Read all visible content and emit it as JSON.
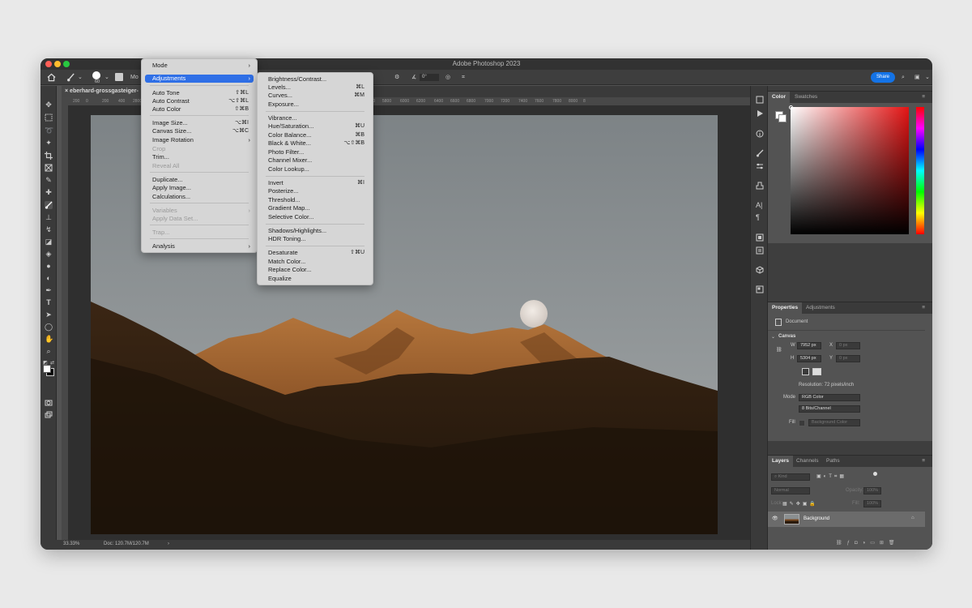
{
  "app": {
    "title": "Adobe Photoshop 2023"
  },
  "options_bar": {
    "brush_size": "60",
    "mode_label": "Mo",
    "angle_value": "0°",
    "share_label": "Share"
  },
  "document": {
    "tab_title": "eberhard-grossgasteiger-",
    "zoom": "33.33%",
    "doc_info": "Doc: 120.7M/120.7M",
    "status_arrow": "›"
  },
  "ruler": {
    "ticks": [
      "200",
      "0",
      "200",
      "400",
      "2800",
      "3000",
      "3200",
      "3400",
      "3600",
      "3800",
      "4000",
      "4200",
      "4400",
      "4600",
      "4800",
      "5000",
      "5200",
      "5400",
      "5600",
      "5800",
      "6000",
      "6200",
      "6400",
      "6600",
      "6800",
      "7000",
      "7200",
      "7400",
      "7600",
      "7800",
      "8000",
      "8"
    ]
  },
  "image_menu": {
    "items": [
      {
        "label": "Mode",
        "shortcut": "",
        "submenu": true,
        "disabled": false,
        "highlighted": false
      },
      {
        "label": "Adjustments",
        "shortcut": "",
        "submenu": true,
        "disabled": false,
        "highlighted": true
      },
      {
        "label": "Auto Tone",
        "shortcut": "⇧⌘L",
        "submenu": false,
        "disabled": false,
        "highlighted": false
      },
      {
        "label": "Auto Contrast",
        "shortcut": "⌥⇧⌘L",
        "submenu": false,
        "disabled": false,
        "highlighted": false
      },
      {
        "label": "Auto Color",
        "shortcut": "⇧⌘B",
        "submenu": false,
        "disabled": false,
        "highlighted": false
      },
      {
        "label": "Image Size...",
        "shortcut": "⌥⌘I",
        "submenu": false,
        "disabled": false,
        "highlighted": false
      },
      {
        "label": "Canvas Size...",
        "shortcut": "⌥⌘C",
        "submenu": false,
        "disabled": false,
        "highlighted": false
      },
      {
        "label": "Image Rotation",
        "shortcut": "",
        "submenu": true,
        "disabled": false,
        "highlighted": false
      },
      {
        "label": "Crop",
        "shortcut": "",
        "submenu": false,
        "disabled": true,
        "highlighted": false
      },
      {
        "label": "Trim...",
        "shortcut": "",
        "submenu": false,
        "disabled": false,
        "highlighted": false
      },
      {
        "label": "Reveal All",
        "shortcut": "",
        "submenu": false,
        "disabled": true,
        "highlighted": false
      },
      {
        "label": "Duplicate...",
        "shortcut": "",
        "submenu": false,
        "disabled": false,
        "highlighted": false
      },
      {
        "label": "Apply Image...",
        "shortcut": "",
        "submenu": false,
        "disabled": false,
        "highlighted": false
      },
      {
        "label": "Calculations...",
        "shortcut": "",
        "submenu": false,
        "disabled": false,
        "highlighted": false
      },
      {
        "label": "Variables",
        "shortcut": "",
        "submenu": true,
        "disabled": true,
        "highlighted": false
      },
      {
        "label": "Apply Data Set...",
        "shortcut": "",
        "submenu": false,
        "disabled": true,
        "highlighted": false
      },
      {
        "label": "Trap...",
        "shortcut": "",
        "submenu": false,
        "disabled": true,
        "highlighted": false
      },
      {
        "label": "Analysis",
        "shortcut": "",
        "submenu": true,
        "disabled": false,
        "highlighted": false
      }
    ]
  },
  "adjustments_menu": {
    "items": [
      {
        "label": "Brightness/Contrast...",
        "shortcut": ""
      },
      {
        "label": "Levels...",
        "shortcut": "⌘L"
      },
      {
        "label": "Curves...",
        "shortcut": "⌘M"
      },
      {
        "label": "Exposure...",
        "shortcut": ""
      },
      {
        "label": "Vibrance...",
        "shortcut": ""
      },
      {
        "label": "Hue/Saturation...",
        "shortcut": "⌘U"
      },
      {
        "label": "Color Balance...",
        "shortcut": "⌘B"
      },
      {
        "label": "Black & White...",
        "shortcut": "⌥⇧⌘B"
      },
      {
        "label": "Photo Filter...",
        "shortcut": ""
      },
      {
        "label": "Channel Mixer...",
        "shortcut": ""
      },
      {
        "label": "Color Lookup...",
        "shortcut": ""
      },
      {
        "label": "Invert",
        "shortcut": "⌘I"
      },
      {
        "label": "Posterize...",
        "shortcut": ""
      },
      {
        "label": "Threshold...",
        "shortcut": ""
      },
      {
        "label": "Gradient Map...",
        "shortcut": ""
      },
      {
        "label": "Selective Color...",
        "shortcut": ""
      },
      {
        "label": "Shadows/Highlights...",
        "shortcut": ""
      },
      {
        "label": "HDR Toning...",
        "shortcut": ""
      },
      {
        "label": "Desaturate",
        "shortcut": "⇧⌘U"
      },
      {
        "label": "Match Color...",
        "shortcut": ""
      },
      {
        "label": "Replace Color...",
        "shortcut": ""
      },
      {
        "label": "Equalize",
        "shortcut": ""
      }
    ]
  },
  "color_panel": {
    "tabs": [
      "Color",
      "Swatches"
    ]
  },
  "properties_panel": {
    "tabs": [
      "Properties",
      "Adjustments"
    ],
    "doc_label": "Document",
    "section": "Canvas",
    "w_label": "W",
    "width": "7952 px",
    "h_label": "H",
    "height": "5304 px",
    "x_label": "X",
    "x_value": "0 px",
    "y_label": "Y",
    "y_value": "0 px",
    "resolution": "Resolution: 72 pixels/inch",
    "mode_label": "Mode",
    "mode_value": "RGB Color",
    "depth_value": "8 Bits/Channel",
    "fill_label": "Fill",
    "fill_value": "Background Color"
  },
  "layers_panel": {
    "tabs": [
      "Layers",
      "Channels",
      "Paths"
    ],
    "filter_label": "Kind",
    "blend_mode": "Normal",
    "opacity_label": "Opacity:",
    "opacity_value": "100%",
    "lock_label": "Lock:",
    "fill_label": "Fill:",
    "fill_value": "100%",
    "layer_name": "Background"
  },
  "colors": {
    "highlight": "#2f6fe6",
    "share": "#1473e6"
  }
}
